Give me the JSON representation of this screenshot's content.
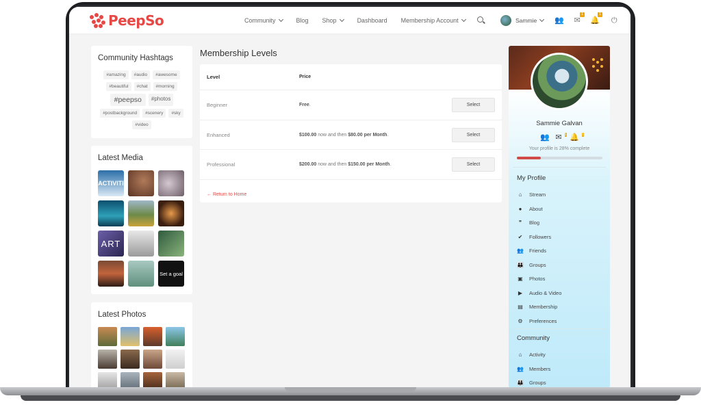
{
  "header": {
    "logo_text": "PeepSo",
    "nav": [
      {
        "label": "Community",
        "dropdown": true
      },
      {
        "label": "Blog",
        "dropdown": false
      },
      {
        "label": "Shop",
        "dropdown": true
      },
      {
        "label": "Dashboard",
        "dropdown": false
      },
      {
        "label": "Membership Account",
        "dropdown": true
      }
    ],
    "user_name": "Sammie",
    "friends_badge": "",
    "messages_badge": "1",
    "notifications_badge": "1"
  },
  "hashtags": {
    "title": "Community Hashtags",
    "tags": [
      "#amazing",
      "#audio",
      "#awesome",
      "#beautiful",
      "#chat",
      "#morning",
      "#peepso",
      "#photos",
      "#postbackground",
      "#scenery",
      "#sky",
      "#video"
    ]
  },
  "latest_media": {
    "title": "Latest Media",
    "thumb_texts": [
      "ACTIVITI",
      "",
      "",
      "",
      "",
      "",
      "ART",
      "",
      "",
      "",
      "",
      "Set a goal"
    ]
  },
  "latest_photos": {
    "title": "Latest Photos"
  },
  "membership": {
    "title": "Membership Levels",
    "col_level": "Level",
    "col_price": "Price",
    "rows": [
      {
        "level": "Beginner",
        "price_main": "Free",
        "price_mid": ".",
        "price_recur": "",
        "price_end": "",
        "button": "Select"
      },
      {
        "level": "Enhanced",
        "price_main": "$100.00",
        "price_mid": " now and then ",
        "price_recur": "$80.00 per Month",
        "price_end": ".",
        "button": "Select"
      },
      {
        "level": "Professional",
        "price_main": "$200.00",
        "price_mid": " now and then ",
        "price_recur": "$150.00 per Month",
        "price_end": ".",
        "button": "Select"
      }
    ],
    "return_link": "← Return to Home"
  },
  "profile": {
    "name": "Sammie Galvan",
    "complete_text": "Your profile is 28% complete",
    "complete_fraction": 0.28,
    "messages_badge": "1",
    "notifications_badge": "1",
    "my_profile_title": "My Profile",
    "my_profile_items": [
      "Stream",
      "About",
      "Blog",
      "Followers",
      "Friends",
      "Groups",
      "Photos",
      "Audio & Video",
      "Membership",
      "Preferences"
    ],
    "community_title": "Community",
    "community_items": [
      "Activity",
      "Members",
      "Groups"
    ]
  },
  "colors": {
    "brand": "#e64845",
    "badge": "#f0a500",
    "progress": "#d04b48"
  }
}
